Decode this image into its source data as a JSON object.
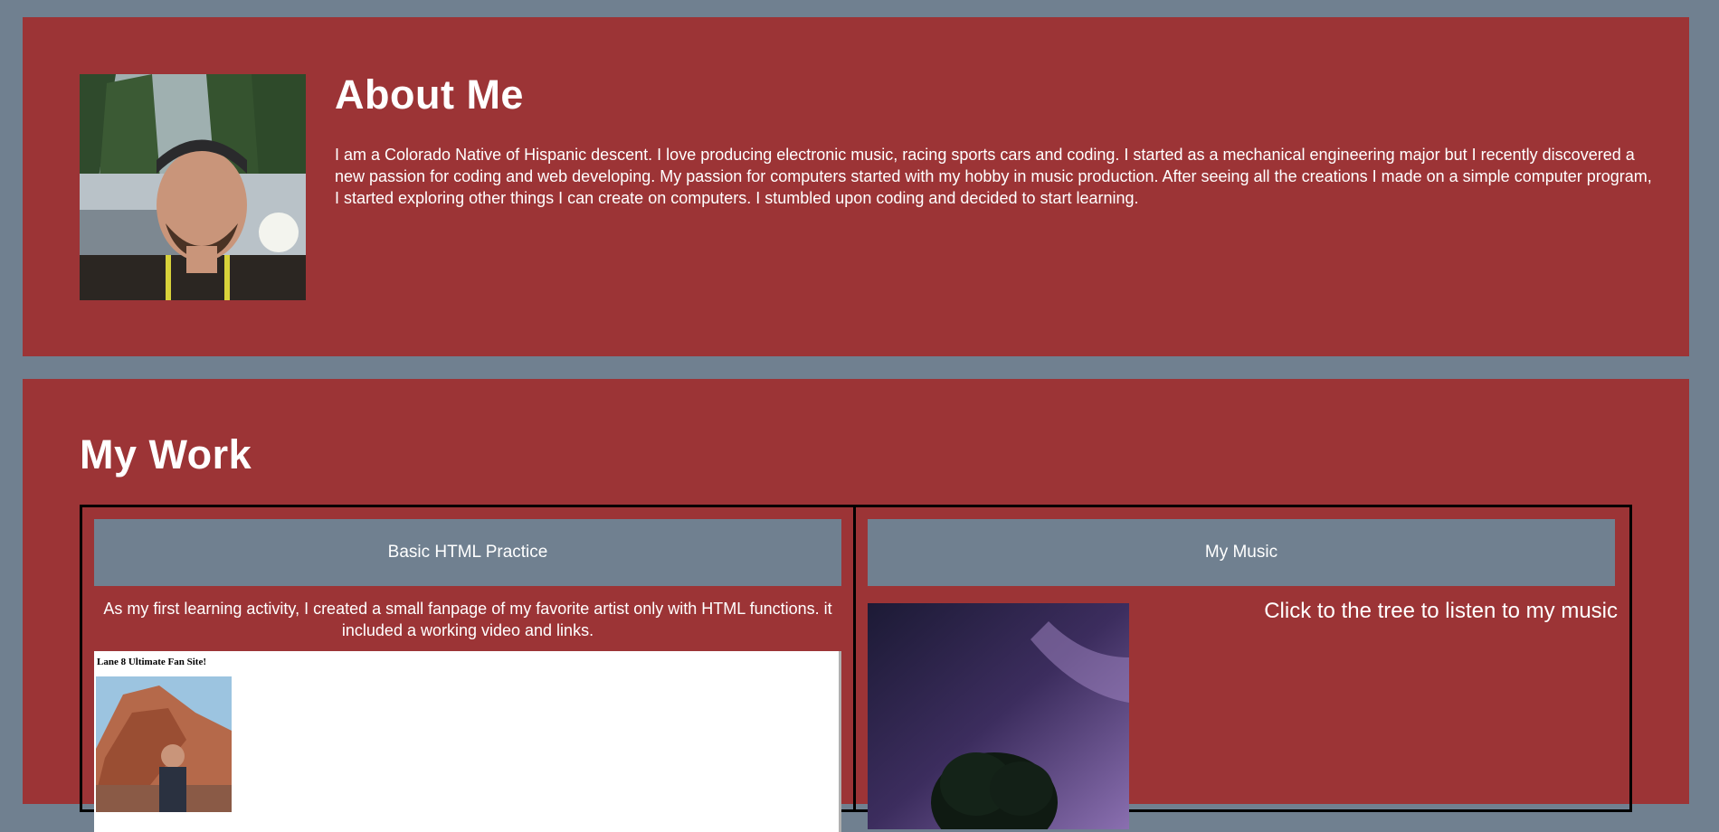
{
  "about": {
    "title": "About Me",
    "text": "I am a Colorado Native of Hispanic descent. I love producing electronic music, racing sports cars and coding. I started as a mechanical engineering major but I recently discovered a new passion for coding and web developing. My passion for computers started with my hobby in music production. After seeing all the creations I made on a simple computer program, I started exploring other things I can create on computers. I stumbled upon coding and decided to start learning."
  },
  "work": {
    "title": "My Work",
    "projects": [
      {
        "label": "Basic HTML Practice",
        "description": "As my first learning activity, I created a small fanpage of my favorite artist only with HTML functions. it included a working video and links.",
        "preview_title": "Lane 8 Ultimate Fan Site!"
      },
      {
        "label": "My Music",
        "cta": "Click to the tree to listen to my music"
      }
    ]
  },
  "colors": {
    "page_background": "#708090",
    "panel_background": "#9c3436",
    "card_header": "#708090",
    "text": "#ffffff"
  }
}
